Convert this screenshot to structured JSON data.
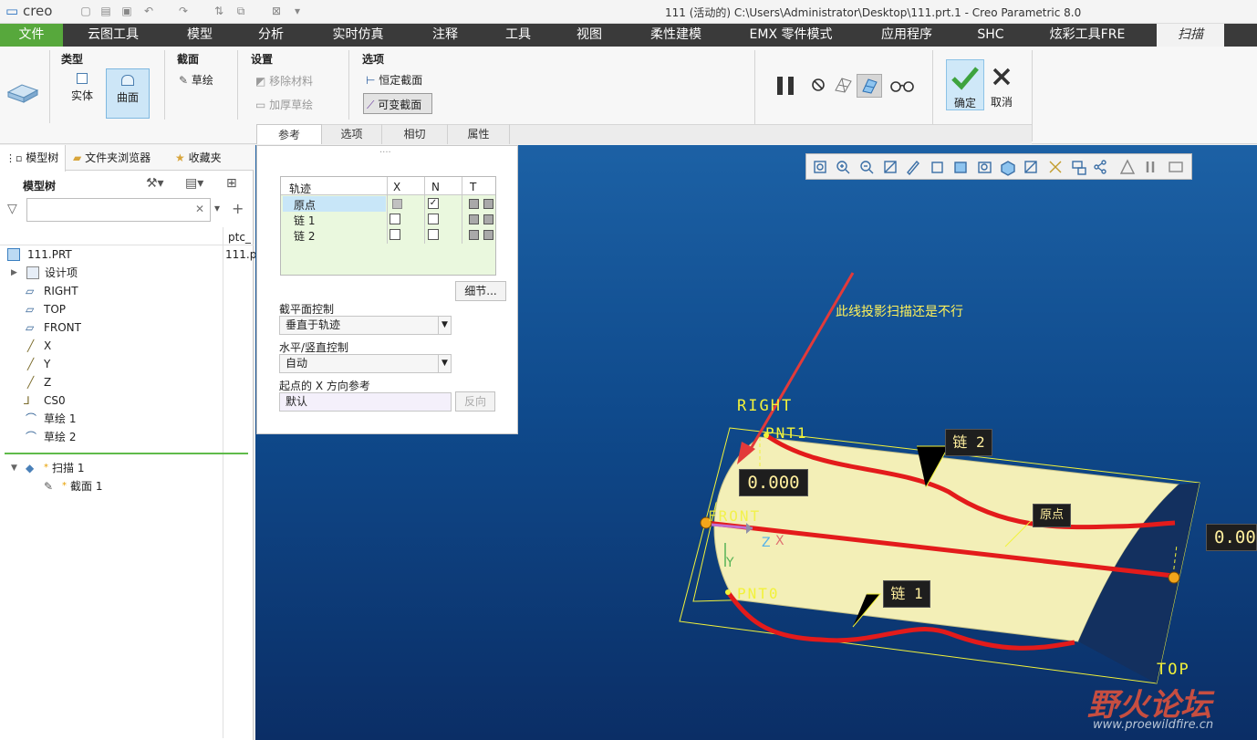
{
  "app": {
    "logo_text": "creo",
    "window_title": "111 (活动的) C:\\Users\\Administrator\\Desktop\\111.prt.1 - Creo Parametric 8.0"
  },
  "menu": {
    "items": [
      "文件",
      "云图工具",
      "模型",
      "分析",
      "实时仿真",
      "注释",
      "工具",
      "视图",
      "柔性建模",
      "EMX 零件模式",
      "应用程序",
      "SHC",
      "炫彩工具FRE",
      "扫描"
    ]
  },
  "ribbon": {
    "type_title": "类型",
    "type_solid": "实体",
    "type_surface": "曲面",
    "section_title": "截面",
    "section_sketch": "草绘",
    "settings_title": "设置",
    "remove_material": "移除材料",
    "thicken_sketch": "加厚草绘",
    "options_title": "选项",
    "constant_section": "恒定截面",
    "variable_section": "可变截面",
    "ok": "确定",
    "cancel": "取消",
    "tabs": [
      "参考",
      "选项",
      "相切",
      "属性"
    ]
  },
  "left": {
    "tab_model_tree": "模型树",
    "tab_folder": "文件夹浏览器",
    "tab_favorites": "收藏夹",
    "tree_title": "模型树",
    "col_header": "ptc_",
    "col_value": "111.p",
    "items": [
      {
        "label": "111.PRT",
        "icon": "part-icon"
      },
      {
        "label": "设计项",
        "icon": "design-items-icon"
      },
      {
        "label": "RIGHT",
        "icon": "datum-plane-icon"
      },
      {
        "label": "TOP",
        "icon": "datum-plane-icon"
      },
      {
        "label": "FRONT",
        "icon": "datum-plane-icon"
      },
      {
        "label": "X",
        "icon": "datum-axis-icon"
      },
      {
        "label": "Y",
        "icon": "datum-axis-icon"
      },
      {
        "label": "Z",
        "icon": "datum-axis-icon"
      },
      {
        "label": "CS0",
        "icon": "coord-system-icon"
      },
      {
        "label": "草绘 1",
        "icon": "sketch-icon"
      },
      {
        "label": "草绘 2",
        "icon": "sketch-icon"
      }
    ],
    "feature": {
      "label": "扫描 1",
      "marker": "*"
    },
    "sub_feature": {
      "label": "截面 1",
      "marker": "*"
    }
  },
  "refpanel": {
    "col_traj": "轨迹",
    "col_x": "X",
    "col_n": "N",
    "col_t": "T",
    "rows": [
      {
        "label": "原点",
        "x": "gray",
        "n": true
      },
      {
        "label": "链 1",
        "x": false,
        "n": false
      },
      {
        "label": "链 2",
        "x": false,
        "n": false
      }
    ],
    "details_btn": "细节...",
    "section_ctrl_label": "截平面控制",
    "section_ctrl_value": "垂直于轨迹",
    "hv_ctrl_label": "水平/竖直控制",
    "hv_ctrl_value": "自动",
    "x_ref_label": "起点的 X 方向参考",
    "x_ref_value": "默认",
    "reverse_btn": "反向"
  },
  "viewport": {
    "annotation": "此线投影扫描还是不行",
    "dim1": "0.000",
    "dim2": "0.00",
    "label_right": "RIGHT",
    "label_top": "TOP",
    "label_front": "FRONT",
    "label_pnt1": "PNT1",
    "label_pnt0": "PNT0",
    "label_chain2": "链 2",
    "label_chain1": "链 1",
    "label_origin": "原点",
    "axis_z": "Z",
    "axis_x": "X",
    "axis_y": "Y",
    "watermark_cn": "野火论坛",
    "watermark_url": "www.proewildfire.cn"
  },
  "colors": {
    "menubar": "#3a3a3a",
    "file_tab": "#57a83c",
    "viewport_top": "#1c61a5",
    "viewport_bottom": "#0b2e66",
    "surface": "#f3efb7",
    "trajectory": "#e31b1b",
    "datum": "#f2f23a"
  }
}
